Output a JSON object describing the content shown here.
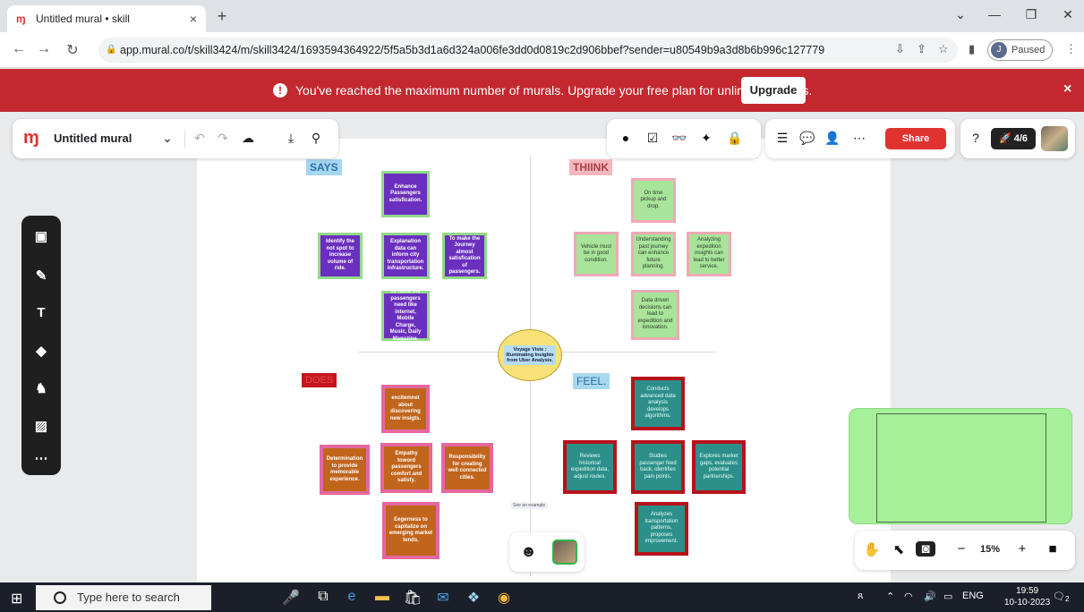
{
  "browser": {
    "tab_title": "Untitled mural • skill",
    "tab_close": "×",
    "new_tab": "+",
    "url": "app.mural.co/t/skill3424/m/skill3424/1693594364922/5f5a5b3d1a6d324a006fe3dd0d0819c2d906bbef?sender=u80549b9a3d8b6b996c127779",
    "profile_initial": "J",
    "profile_status": "Paused",
    "window_buttons": [
      "⌄",
      "—",
      "❐",
      "✕"
    ]
  },
  "banner": {
    "message": "You've reached the maximum number of murals. Upgrade your free plan for unlimited murals.",
    "upgrade_label": "Upgrade",
    "close": "×",
    "color": "#c4282f"
  },
  "toolbar": {
    "mural_title": "Untitled mural",
    "share_label": "Share",
    "progress_label": "4/6"
  },
  "zoom": {
    "level": "15%"
  },
  "board": {
    "quadrants": {
      "says": "SAYS",
      "think": "THIINK",
      "does": "DOES",
      "feel": "FEEL."
    },
    "center": "Voyage Viste : Illuminating Insights from Uber Analysis.",
    "tiny_label": "See an example",
    "notes": {
      "says": [
        "Enhance Passengers satisfication.",
        "Identify the not spot to increase volume of ride.",
        "Explanation data can inform city transportation infrastructure.",
        "To make the Journey almost satisfication of passengers.",
        "To fulfill  the passengers need like internet, Mobile Charge, Music, Daily Magazine."
      ],
      "think": [
        "On time pickup and drop.",
        "Vehicle must be in good condition.",
        "Understanding past journey can enhance future planning.",
        "Analyzing expedition insights can lead to better service.",
        "Data driven decisions can lead to expedition and innovation."
      ],
      "does": [
        "excitemnet about discovering new insigts.",
        "Determination to provide memorable experience.",
        "Empathy toword passengers comfort and satisfy.",
        "Responsibility for creating well connected cities.",
        "Eegerness to capitalize on emerging market tends."
      ],
      "feel": [
        "Conducts advanced data analysis develops algorithms.",
        "Reviews historical expedition data, adjust routes.",
        "Studies passenger feed back, identifies pain points.",
        "Explores market gaps, evaluates potential partnerships.",
        "Analyzes transportation patterns, proposes improvement."
      ]
    }
  },
  "taskbar": {
    "search_placeholder": "Type here to search",
    "time": "19:59",
    "date": "10-10-2023",
    "language": "ENG",
    "notification_count": "2"
  }
}
